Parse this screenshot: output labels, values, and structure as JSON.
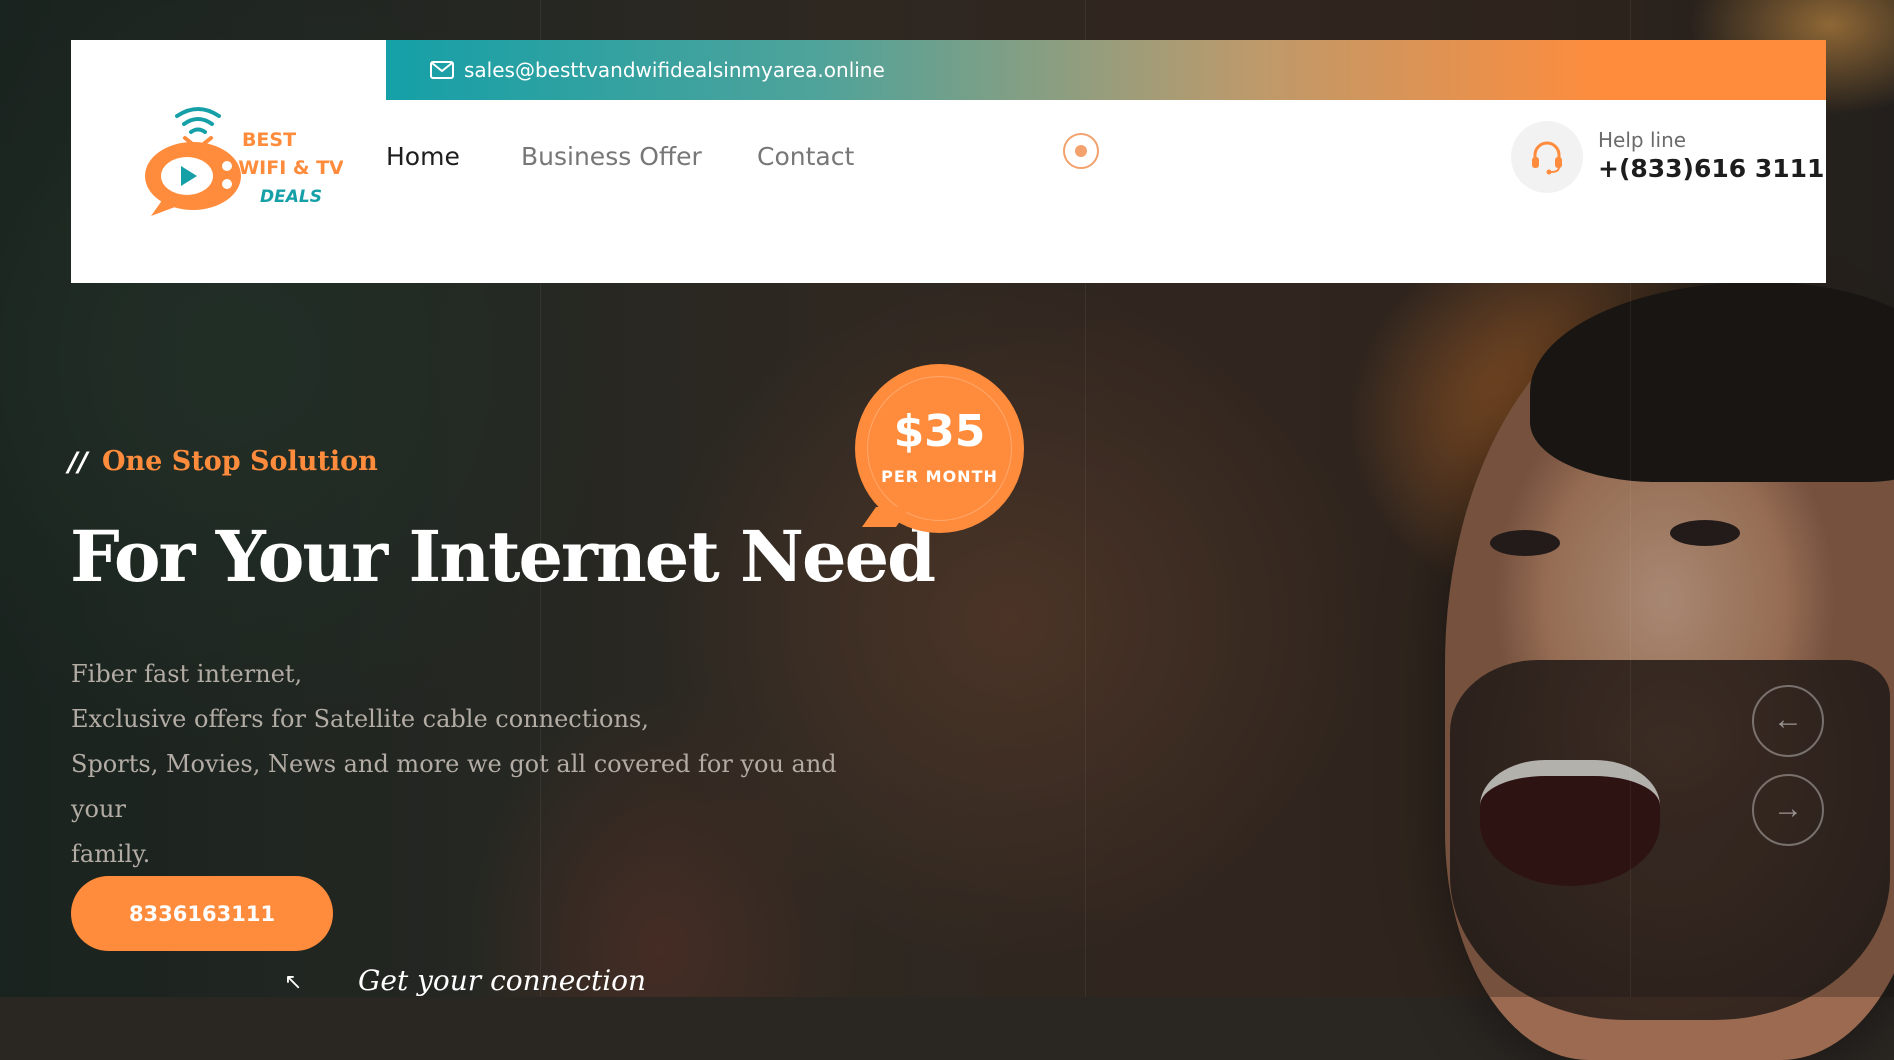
{
  "topbar": {
    "email": "sales@besttvandwifidealsinmyarea.online",
    "mail_icon": "mail-icon"
  },
  "logo": {
    "line1": "BEST",
    "line2": "WIFI & TV",
    "line3": "DEALS",
    "icon": "tv-wifi-logo-icon"
  },
  "nav": {
    "items": [
      {
        "label": "Home",
        "active": true
      },
      {
        "label": "Business Offer",
        "active": false
      },
      {
        "label": "Contact",
        "active": false
      }
    ],
    "search_icon": "search-toggle-icon"
  },
  "help": {
    "label": "Help line",
    "phone": "+(833)616 3111",
    "icon": "headset-icon"
  },
  "hero": {
    "kicker_prefix": "//",
    "kicker": "One Stop Solution",
    "headline": "For Your Internet Need",
    "lines": [
      "Fiber fast internet,",
      "Exclusive offers for Satellite cable connections,",
      "Sports, Movies, News and more we got all covered for you and your",
      "family."
    ],
    "cta_label": "8336163111",
    "script_text": "Get your connection"
  },
  "price": {
    "amount": "$35",
    "unit": "PER MONTH"
  },
  "slider": {
    "prev_icon": "arrow-left-icon",
    "next_icon": "arrow-right-icon",
    "prev_glyph": "←",
    "next_glyph": "→"
  },
  "colors": {
    "accent": "#ff8c3c",
    "teal": "#15a0a8",
    "text_dark": "#1d1d1d",
    "nav_muted": "#777777"
  }
}
